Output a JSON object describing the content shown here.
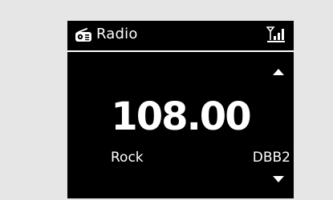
{
  "header": {
    "title": "Radio",
    "left_icon": "radio-icon",
    "right_icon": "signal-strength-icon"
  },
  "tuner": {
    "frequency": "108.00",
    "genre": "Rock",
    "station": "DBB2"
  },
  "navigation": {
    "up_icon": "up-arrow-icon",
    "down_icon": "down-arrow-icon"
  },
  "colors": {
    "background": "#e6e6e6",
    "screen": "#000000",
    "foreground": "#ffffff"
  }
}
